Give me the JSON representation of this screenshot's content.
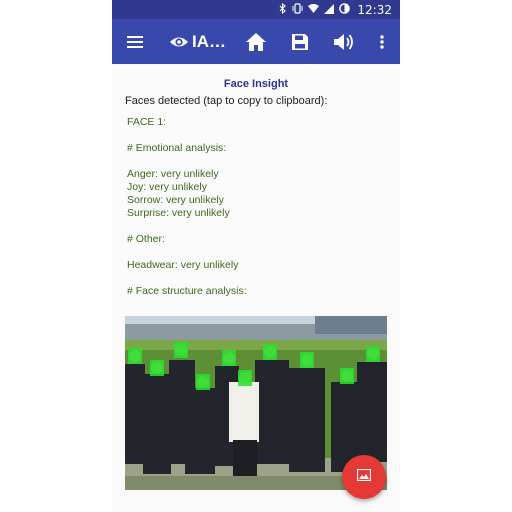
{
  "status_bar": {
    "time": "12:32"
  },
  "toolbar": {
    "app_title": "IA…",
    "icons": [
      "menu-icon",
      "eye-icon",
      "home-icon",
      "save-icon",
      "speaker-icon",
      "more-vert-icon"
    ]
  },
  "content": {
    "title": "Face Insight",
    "subtitle": "Faces detected (tap to copy to clipboard):",
    "lines": [
      "FACE 1:",
      "",
      "# Emotional analysis:",
      "",
      "Anger: very unlikely",
      "Joy: very unlikely",
      "Sorrow: very unlikely",
      "Surprise: very unlikely",
      "",
      "# Other:",
      "",
      "Headwear: very unlikely",
      "",
      "# Face structure analysis:"
    ]
  },
  "photo": {
    "description_icon": "group-photo-with-face-boxes"
  },
  "colors": {
    "toolbar": "#3949ab",
    "status_bar": "#2f3990",
    "result_text": "#3b6b1f",
    "title": "#2b3590",
    "fab": "#e53935",
    "face_box": "#27e32e"
  }
}
